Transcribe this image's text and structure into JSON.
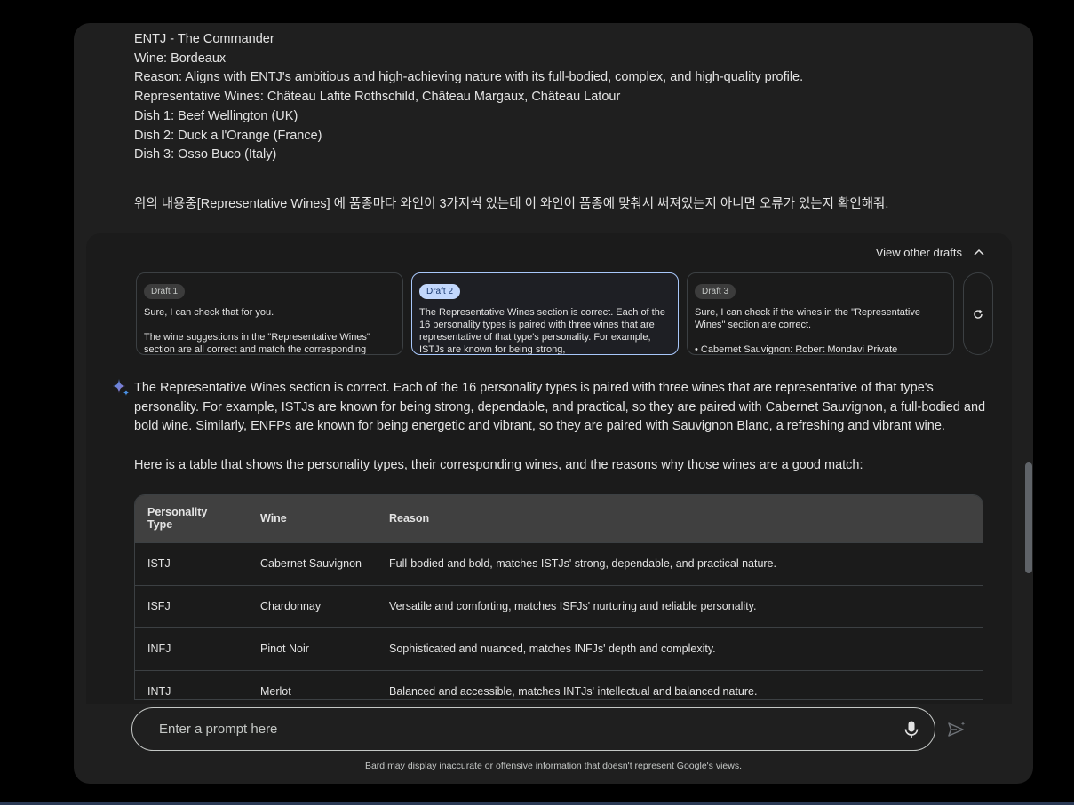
{
  "user_message": {
    "lines": [
      "ENTJ - The Commander",
      "Wine: Bordeaux",
      "Reason: Aligns with ENTJ's ambitious and high-achieving nature with its full-bodied, complex, and high-quality profile.",
      "Representative Wines: Château Lafite Rothschild, Château Margaux, Château Latour",
      "Dish 1: Beef Wellington (UK)",
      "Dish 2: Duck a l'Orange (France)",
      "Dish 3: Osso Buco (Italy)"
    ],
    "question": "위의 내용중[Representative Wines] 에  품종마다 와인이 3가지씩 있는데 이 와인이 품종에 맞춰서 써져있는지 아니면 오류가 있는지 확인해줘."
  },
  "drafts": {
    "toggle_label": "View other drafts",
    "items": [
      {
        "badge": "Draft 1",
        "text": "Sure, I can check that for you.\n\nThe wine suggestions in the \"Representative Wines\" section are all correct and match the corresponding"
      },
      {
        "badge": "Draft 2",
        "text": "The Representative Wines section is correct. Each of the 16 personality types is paired with three wines that are representative of that type's personality. For example, ISTJs are known for being strong,"
      },
      {
        "badge": "Draft 3",
        "text": "Sure, I can check if the wines in the \"Representative Wines\" section are correct.\n\n    •   Cabernet Sauvignon: Robert Mondavi Private"
      }
    ]
  },
  "response": {
    "paragraph1": "The Representative Wines section is correct. Each of the 16 personality types is paired with three wines that are representative of that type's personality. For example, ISTJs are known for being strong, dependable, and practical, so they are paired with Cabernet Sauvignon, a full-bodied and bold wine. Similarly, ENFPs are known for being energetic and vibrant, so they are paired with Sauvignon Blanc, a refreshing and vibrant wine.",
    "paragraph2": "Here is a table that shows the personality types, their corresponding wines, and the reasons why those wines are a good match:",
    "table": {
      "headers": [
        "Personality Type",
        "Wine",
        "Reason"
      ],
      "rows": [
        [
          "ISTJ",
          "Cabernet Sauvignon",
          "Full-bodied and bold, matches ISTJs' strong, dependable, and practical nature."
        ],
        [
          "ISFJ",
          "Chardonnay",
          "Versatile and comforting, matches ISFJs' nurturing and reliable personality."
        ],
        [
          "INFJ",
          "Pinot Noir",
          "Sophisticated and nuanced, matches INFJs' depth and complexity."
        ],
        [
          "INTJ",
          "Merlot",
          "Balanced and accessible, matches INTJs' intellectual and balanced nature."
        ]
      ]
    }
  },
  "composer": {
    "placeholder": "Enter a prompt here"
  },
  "disclaimer": "Bard may display inaccurate or offensive information that doesn't represent Google's views.",
  "colors": {
    "background": "#000000",
    "panel": "#1f1f1f",
    "selected_draft_border": "#a8c7fa",
    "sparkle_blue": "#4a90e2"
  }
}
